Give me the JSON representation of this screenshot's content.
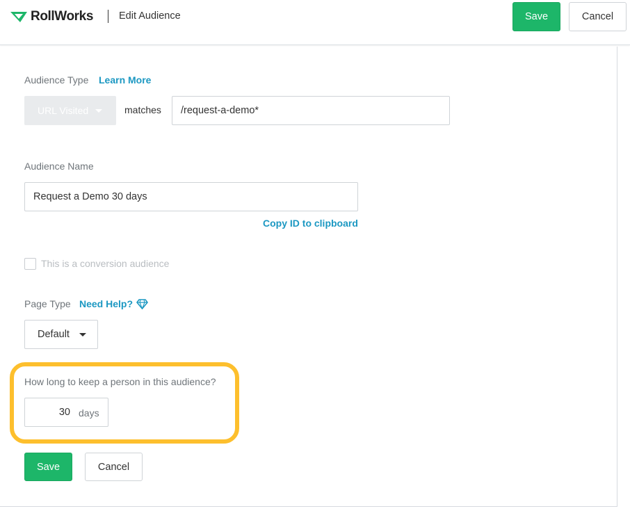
{
  "header": {
    "logo_text": "RollWorks",
    "title": "Edit Audience",
    "save_label": "Save",
    "cancel_label": "Cancel"
  },
  "audience_type": {
    "label": "Audience Type",
    "learn_more": "Learn More",
    "type_value": "URL Visited",
    "operator": "matches",
    "url_value": "/request-a-demo*"
  },
  "audience_name": {
    "label": "Audience Name",
    "value": "Request a Demo 30 days",
    "copy_id": "Copy ID to clipboard"
  },
  "conversion": {
    "label": "This is a conversion audience",
    "checked": false
  },
  "page_type": {
    "label": "Page Type",
    "need_help": "Need Help?",
    "value": "Default"
  },
  "duration": {
    "label": "How long to keep a person in this audience?",
    "value": "30",
    "unit": "days"
  },
  "footer": {
    "save_label": "Save",
    "cancel_label": "Cancel"
  },
  "colors": {
    "primary_green": "#1db669",
    "link_blue": "#1c98c2",
    "highlight_yellow": "#fdbf2d"
  },
  "icons": [
    "rollworks-logo-icon",
    "caret-down-icon",
    "diamond-icon"
  ]
}
